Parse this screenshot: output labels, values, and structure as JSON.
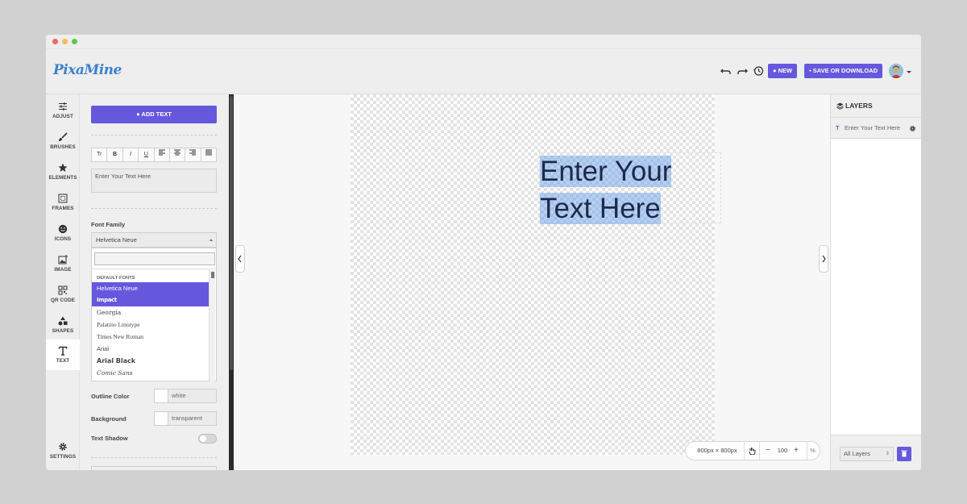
{
  "app": {
    "logo": "PixaMine"
  },
  "toolbar": {
    "new_label": "NEW",
    "save_label": "SAVE OR DOWNLOAD",
    "accent": "#6658dd"
  },
  "nav": {
    "items": [
      {
        "label": "ADJUST",
        "icon": "sliders-icon"
      },
      {
        "label": "BRUSHES",
        "icon": "brush-icon"
      },
      {
        "label": "ELEMENTS",
        "icon": "star-icon"
      },
      {
        "label": "FRAMES",
        "icon": "frame-icon"
      },
      {
        "label": "ICONS",
        "icon": "smiley-icon"
      },
      {
        "label": "IMAGE",
        "icon": "image-icon"
      },
      {
        "label": "QR CODE",
        "icon": "qr-icon"
      },
      {
        "label": "SHAPES",
        "icon": "shapes-icon"
      },
      {
        "label": "TEXT",
        "icon": "text-icon"
      }
    ],
    "settings": "SETTINGS"
  },
  "panel": {
    "add_text": "ADD TEXT",
    "format_buttons": [
      "Tr",
      "B",
      "I",
      "U"
    ],
    "text_value": "Enter Your Text Here",
    "font_family_label": "Font Family",
    "font_family_value": "Helvetica Neue",
    "dropdown_group": "DEFAULT FONTS",
    "fonts": [
      "Helvetica Neue",
      "Impact",
      "Georgia",
      "Palatino Linotype",
      "Times New Roman",
      "Arial",
      "Arial Black",
      "Comic Sans"
    ],
    "outline_color_label": "Outline Color",
    "outline_color_value": "white",
    "background_label": "Background",
    "background_value": "transparent",
    "text_shadow_label": "Text Shadow"
  },
  "canvas": {
    "line1": "Enter Your",
    "line2": "Text Here",
    "size": "800px × 800px",
    "zoom": "100",
    "zoom_unit": "%"
  },
  "layers": {
    "title": "LAYERS",
    "row_label": "Enter Your Text Here",
    "row_type": "T",
    "filter": "All Layers"
  }
}
